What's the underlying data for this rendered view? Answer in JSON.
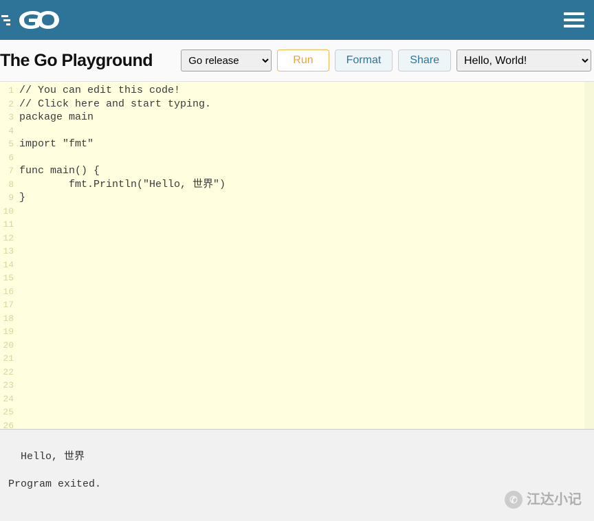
{
  "nav": {
    "logo_label": "Go"
  },
  "toolbar": {
    "title": "The Go Playground",
    "release_selected": "Go release",
    "run_label": "Run",
    "format_label": "Format",
    "share_label": "Share",
    "example_selected": "Hello, World!"
  },
  "editor": {
    "total_lines": 26,
    "lines": [
      "// You can edit this code!",
      "// Click here and start typing.",
      "package main",
      "",
      "import \"fmt\"",
      "",
      "func main() {",
      "        fmt.Println(\"Hello, 世界\")",
      "}",
      "",
      "",
      "",
      "",
      "",
      "",
      "",
      "",
      "",
      "",
      "",
      "",
      "",
      "",
      "",
      "",
      ""
    ]
  },
  "output": {
    "text": "Hello, 世界\n\nProgram exited."
  },
  "watermark": {
    "text": "江达小记"
  }
}
